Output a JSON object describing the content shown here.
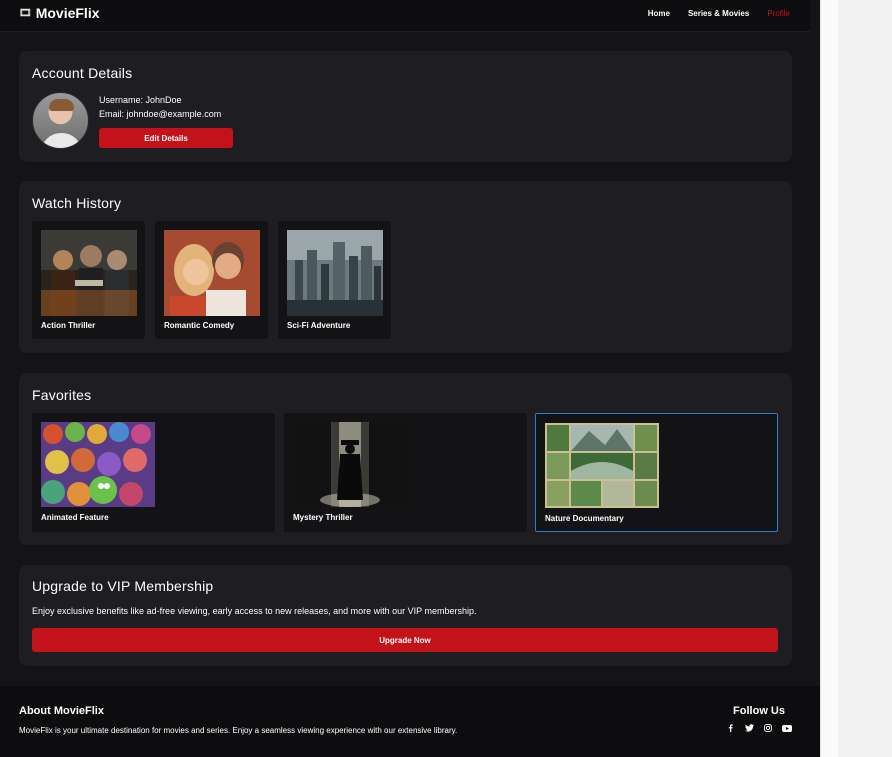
{
  "brand": {
    "icon": "film-icon",
    "name": "MovieFlix"
  },
  "nav": {
    "items": [
      {
        "label": "Home",
        "active": false
      },
      {
        "label": "Series & Movies",
        "active": false
      },
      {
        "label": "Profile",
        "active": true
      }
    ]
  },
  "account": {
    "title": "Account Details",
    "username": "Username: JohnDoe",
    "email": "Email: johndoe@example.com",
    "edit_label": "Edit Details"
  },
  "history": {
    "title": "Watch History",
    "items": [
      {
        "label": "Action Thriller"
      },
      {
        "label": "Romantic Comedy"
      },
      {
        "label": "Sci-Fi Adventure"
      }
    ]
  },
  "favorites": {
    "title": "Favorites",
    "items": [
      {
        "label": "Animated Feature"
      },
      {
        "label": "Mystery Thriller"
      },
      {
        "label": "Nature Documentary",
        "selected": true
      }
    ]
  },
  "upgrade": {
    "title": "Upgrade to VIP Membership",
    "text": "Enjoy exclusive benefits like ad-free viewing, early access to new releases, and more with our VIP membership.",
    "button_label": "Upgrade Now"
  },
  "footer": {
    "about_title": "About MovieFlix",
    "about_text": "MovieFlix is your ultimate destination for movies and series. Enjoy a seamless viewing experience with our extensive library.",
    "follow_title": "Follow Us",
    "social": [
      "facebook-icon",
      "twitter-icon",
      "instagram-icon",
      "youtube-icon"
    ]
  },
  "colors": {
    "accent": "#c4121a",
    "background": "#141418",
    "card": "#1d1d22",
    "selection": "#2e7cd0"
  }
}
